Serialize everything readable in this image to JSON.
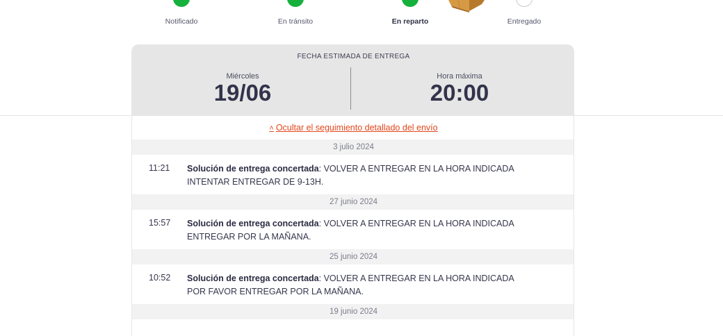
{
  "steps": [
    {
      "label": "Notificado",
      "state": "done"
    },
    {
      "label": "En tránsito",
      "state": "done"
    },
    {
      "label": "En reparto",
      "state": "active"
    },
    {
      "label": "Entregado",
      "state": "pending"
    }
  ],
  "colors": {
    "done": "#16b13d",
    "accent_link": "#e4461c",
    "estimate_bg": "#e6e6e6",
    "date_row_bg": "#f2f2f2"
  },
  "estimate": {
    "title": "FECHA ESTIMADA DE ENTREGA",
    "day_label": "Miércoles",
    "date": "19/06",
    "hour_label": "Hora máxima",
    "hour": "20:00"
  },
  "toggle": {
    "caret": "˄",
    "label": "Ocultar el seguimiento detallado del envío"
  },
  "timeline": {
    "groups": [
      {
        "date": "3 julio 2024",
        "events": [
          {
            "time": "11:21",
            "title": "Solución de entrega concertada",
            "line1": ": VOLVER A ENTREGAR EN LA HORA INDICADA",
            "line2": "INTENTAR ENTREGAR DE 9-13H."
          }
        ]
      },
      {
        "date": "27 junio 2024",
        "events": [
          {
            "time": "15:57",
            "title": "Solución de entrega concertada",
            "line1": ": VOLVER A ENTREGAR EN LA HORA INDICADA",
            "line2": "ENTREGAR POR LA MAÑANA."
          }
        ]
      },
      {
        "date": "25 junio 2024",
        "events": [
          {
            "time": "10:52",
            "title": "Solución de entrega concertada",
            "line1": ": VOLVER A ENTREGAR EN LA HORA INDICADA",
            "line2": "POR FAVOR ENTREGAR POR LA MAÑANA."
          }
        ]
      },
      {
        "date": "19 junio 2024",
        "events": []
      }
    ]
  },
  "icons": {
    "parcel": "parcel-box-icon",
    "step_done": "check-circle-icon",
    "step_pending": "empty-circle-icon"
  }
}
